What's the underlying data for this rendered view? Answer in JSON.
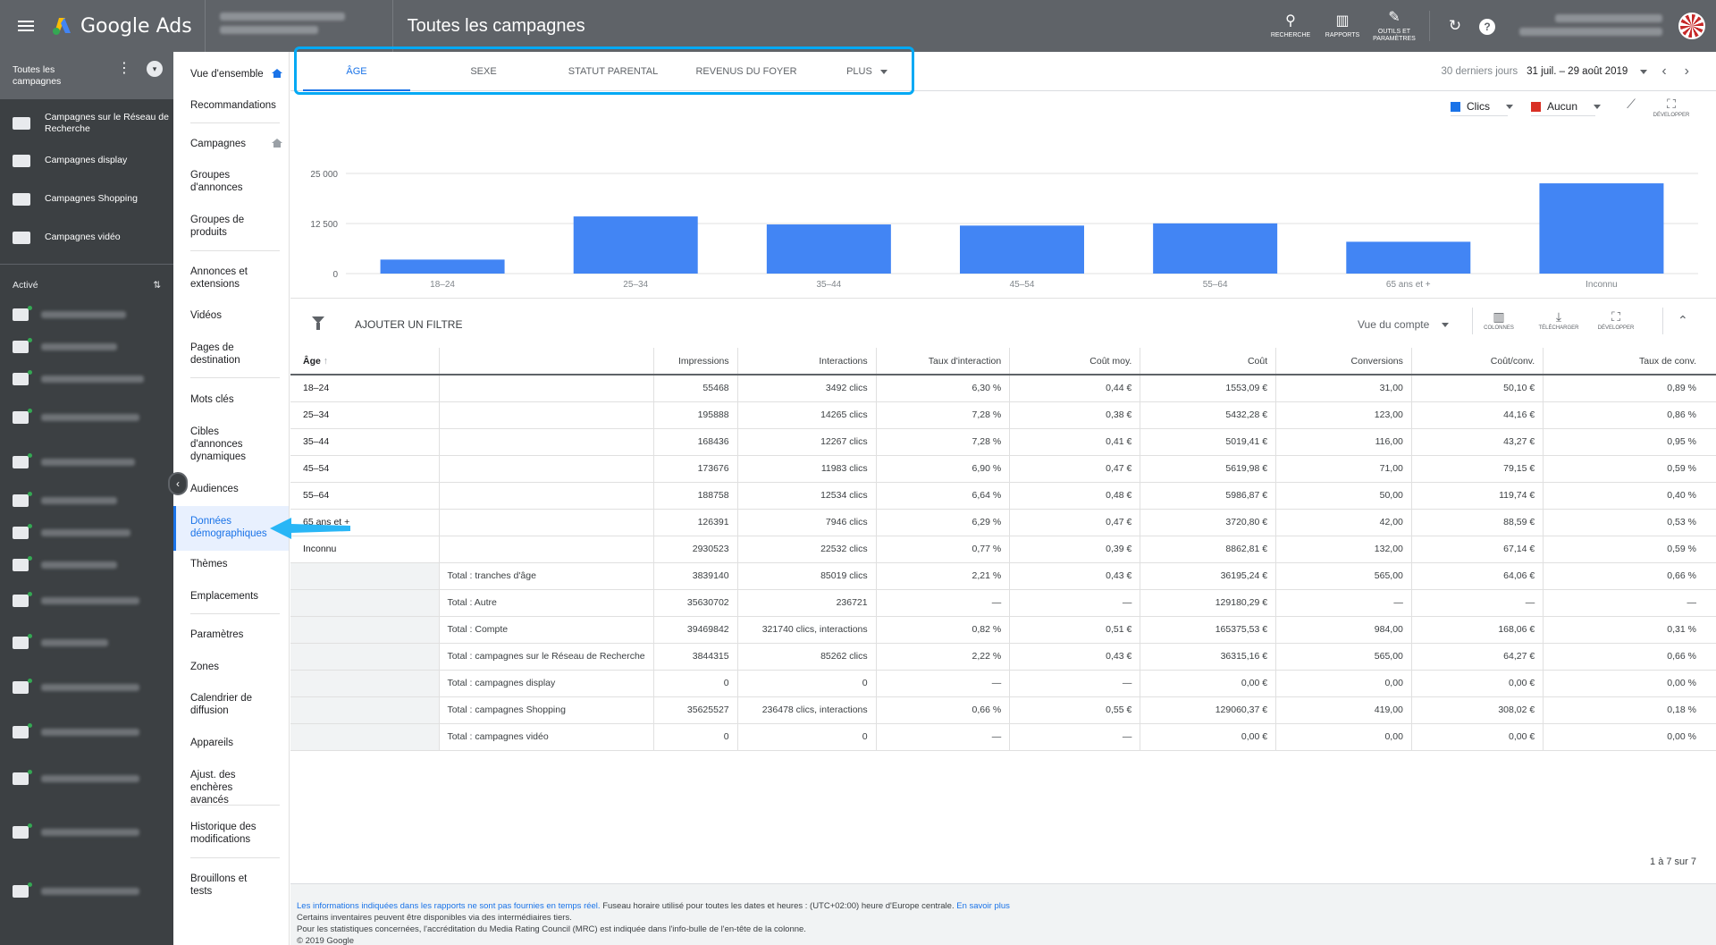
{
  "app": {
    "name": "Google Ads",
    "page_title": "Toutes les campagnes"
  },
  "topbar": {
    "tools": [
      {
        "icon": "search-icon",
        "label": "RECHERCHE"
      },
      {
        "icon": "reports-icon",
        "label": "RAPPORTS"
      },
      {
        "icon": "wrench-icon",
        "label": "OUTILS ET PARAMÈTRES"
      }
    ]
  },
  "leftnav": {
    "all_campaigns": "Toutes les campagnes",
    "campaign_types": [
      "Campagnes sur le Réseau de Recherche",
      "Campagnes display",
      "Campagnes Shopping",
      "Campagnes vidéo"
    ],
    "active_label": "Activé"
  },
  "subnav": {
    "items": [
      "Vue d'ensemble",
      "Recommandations",
      "Campagnes",
      "Groupes d'annonces",
      "Groupes de produits",
      "Annonces et extensions",
      "Vidéos",
      "Pages de destination",
      "Mots clés",
      "Cibles d'annonces dynamiques",
      "Audiences",
      "Données démographiques",
      "Thèmes",
      "Emplacements",
      "Paramètres",
      "Zones",
      "Calendrier de diffusion",
      "Appareils",
      "Ajust. des enchères avancés",
      "Historique des modifications",
      "Brouillons et tests"
    ],
    "active_index": 11
  },
  "tabs": [
    "ÂGE",
    "SEXE",
    "STATUT PARENTAL",
    "REVENUS DU FOYER",
    "PLUS"
  ],
  "active_tab": 0,
  "daterange": {
    "label": "30 derniers jours",
    "value": "31 juil. – 29 août 2019"
  },
  "chart_controls": {
    "metric1": "Clics",
    "metric1_color": "#1a73e8",
    "metric2": "Aucun",
    "metric2_color": "#d93025",
    "expand_label": "DÉVELOPPER"
  },
  "chart_data": {
    "type": "bar",
    "categories": [
      "18–24",
      "25–34",
      "35–44",
      "45–54",
      "55–64",
      "65 ans et +",
      "Inconnu"
    ],
    "series": [
      {
        "name": "Clics",
        "values": [
          3492,
          14265,
          12267,
          11983,
          12534,
          7946,
          22532
        ]
      }
    ],
    "ylim": [
      0,
      25000
    ],
    "yticks": [
      "0",
      "12 500",
      "25 000"
    ],
    "grid": true,
    "bar_color": "#4285f4"
  },
  "filterbar": {
    "add_filter": "AJOUTER UN FILTRE",
    "view": "Vue du compte",
    "icons": [
      "COLONNES",
      "TÉLÉCHARGER",
      "DÉVELOPPER"
    ]
  },
  "table": {
    "columns": [
      "Âge",
      "",
      "Impressions",
      "Interactions",
      "Taux d'interaction",
      "Coût moy.",
      "Coût",
      "Conversions",
      "Coût/conv.",
      "Taux de conv."
    ],
    "rows": [
      [
        "18–24",
        "",
        "55468",
        "3492 clics",
        "6,30 %",
        "0,44 €",
        "1553,09 €",
        "31,00",
        "50,10 €",
        "0,89 %"
      ],
      [
        "25–34",
        "",
        "195888",
        "14265 clics",
        "7,28 %",
        "0,38 €",
        "5432,28 €",
        "123,00",
        "44,16 €",
        "0,86 %"
      ],
      [
        "35–44",
        "",
        "168436",
        "12267 clics",
        "7,28 %",
        "0,41 €",
        "5019,41 €",
        "116,00",
        "43,27 €",
        "0,95 %"
      ],
      [
        "45–54",
        "",
        "173676",
        "11983 clics",
        "6,90 %",
        "0,47 €",
        "5619,98 €",
        "71,00",
        "79,15 €",
        "0,59 %"
      ],
      [
        "55–64",
        "",
        "188758",
        "12534 clics",
        "6,64 %",
        "0,48 €",
        "5986,87 €",
        "50,00",
        "119,74 €",
        "0,40 %"
      ],
      [
        "65 ans et +",
        "",
        "126391",
        "7946 clics",
        "6,29 %",
        "0,47 €",
        "3720,80 €",
        "42,00",
        "88,59 €",
        "0,53 %"
      ],
      [
        "Inconnu",
        "",
        "2930523",
        "22532 clics",
        "0,77 %",
        "0,39 €",
        "8862,81 €",
        "132,00",
        "67,14 €",
        "0,59 %"
      ]
    ],
    "totals": [
      [
        "",
        "Total : tranches d'âge",
        "3839140",
        "85019 clics",
        "2,21 %",
        "0,43 €",
        "36195,24 €",
        "565,00",
        "64,06 €",
        "0,66 %"
      ],
      [
        "",
        "Total : Autre",
        "35630702",
        "236721",
        "—",
        "—",
        "129180,29 €",
        "—",
        "—",
        "—"
      ],
      [
        "",
        "Total : Compte",
        "39469842",
        "321740 clics, interactions",
        "0,82 %",
        "0,51 €",
        "165375,53 €",
        "984,00",
        "168,06 €",
        "0,31 %"
      ],
      [
        "",
        "Total : campagnes sur le Réseau de Recherche",
        "3844315",
        "85262 clics",
        "2,22 %",
        "0,43 €",
        "36315,16 €",
        "565,00",
        "64,27 €",
        "0,66 %"
      ],
      [
        "",
        "Total : campagnes display",
        "0",
        "0",
        "—",
        "—",
        "0,00 €",
        "0,00",
        "0,00 €",
        "0,00 %"
      ],
      [
        "",
        "Total : campagnes Shopping",
        "35625527",
        "236478 clics, interactions",
        "0,66 %",
        "0,55 €",
        "129060,37 €",
        "419,00",
        "308,02 €",
        "0,18 %"
      ],
      [
        "",
        "Total : campagnes vidéo",
        "0",
        "0",
        "—",
        "—",
        "0,00 €",
        "0,00",
        "0,00 €",
        "0,00 %"
      ]
    ]
  },
  "pagination": "1 à 7 sur 7",
  "footer": {
    "line1_link": "Les informations indiquées dans les rapports ne sont pas fournies en temps réel.",
    "line1_text": " Fuseau horaire utilisé pour toutes les dates et heures : (UTC+02:00) heure d'Europe centrale.",
    "line1_link2": " En savoir plus",
    "line2": "Certains inventaires peuvent être disponibles via des intermédiaires tiers.",
    "line3": "Pour les statistiques concernées, l'accréditation du Media Rating Council (MRC) est indiquée dans l'info-bulle de l'en-tête de la colonne.",
    "line4": "© 2019 Google"
  }
}
